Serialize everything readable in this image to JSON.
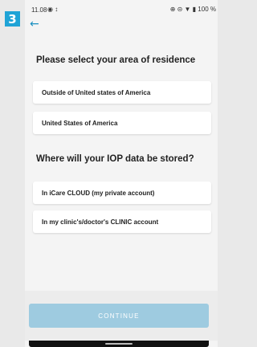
{
  "step_badge": "3",
  "status_bar": {
    "time": "11.08",
    "left_icons": "◉ ↕",
    "right_icons": "⊕ ⊝ ▼ ▮ 100 %"
  },
  "back_icon": "←",
  "residence": {
    "heading": "Please select your area of residence",
    "options": [
      "Outside of United states of America",
      "United States of America"
    ]
  },
  "storage": {
    "heading": "Where will your IOP data be stored?",
    "options": [
      "In iCare CLOUD (my private account)",
      "In my clinic's/doctor's CLINIC account"
    ]
  },
  "continue_label": "CONTINUE",
  "colors": {
    "accent": "#1fa3d6",
    "button_disabled": "#9ecbe0"
  }
}
